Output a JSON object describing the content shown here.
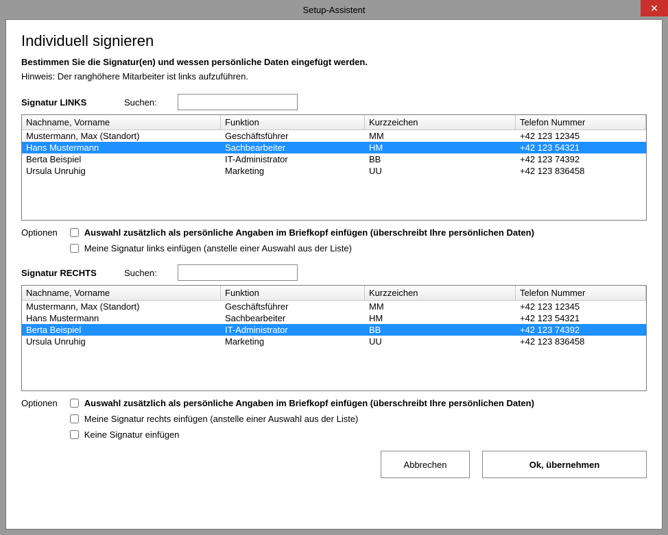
{
  "window": {
    "title": "Setup-Assistent",
    "close": "✕"
  },
  "heading": "Individuell signieren",
  "lead": "Bestimmen Sie die Signatur(en) und wessen persönliche Daten eingefügt werden.",
  "hint": "Hinweis: Der ranghöhere Mitarbeiter ist links aufzuführen.",
  "search_label": "Suchen:",
  "columns": {
    "name": "Nachname, Vorname",
    "func": "Funktion",
    "short": "Kurzzeichen",
    "phone": "Telefon Nummer"
  },
  "left": {
    "title": "Signatur LINKS",
    "search": "",
    "rows": [
      {
        "name": "Mustermann, Max (Standort)",
        "func": "Geschäftsführer",
        "short": "MM",
        "phone": "+42 123 12345",
        "selected": false
      },
      {
        "name": "Hans Mustermann",
        "func": "Sachbearbeiter",
        "short": "HM",
        "phone": "+42 123 54321",
        "selected": true
      },
      {
        "name": "Berta Beispiel",
        "func": "IT-Administrator",
        "short": "BB",
        "phone": "+42 123 74392",
        "selected": false
      },
      {
        "name": "Ursula Unruhig",
        "func": "Marketing",
        "short": "UU",
        "phone": "+42 123 836458",
        "selected": false
      }
    ],
    "options_label": "Optionen",
    "opt1": "Auswahl zusätzlich  als persönliche Angaben im Briefkopf einfügen (überschreibt Ihre persönlichen Daten)",
    "opt2": "Meine Signatur links einfügen (anstelle einer Auswahl aus der Liste)"
  },
  "right": {
    "title": "Signatur RECHTS",
    "search": "",
    "rows": [
      {
        "name": "Mustermann, Max (Standort)",
        "func": "Geschäftsführer",
        "short": "MM",
        "phone": "+42 123 12345",
        "selected": false
      },
      {
        "name": "Hans Mustermann",
        "func": "Sachbearbeiter",
        "short": "HM",
        "phone": "+42 123 54321",
        "selected": false
      },
      {
        "name": "Berta Beispiel",
        "func": "IT-Administrator",
        "short": "BB",
        "phone": "+42 123 74392",
        "selected": true
      },
      {
        "name": "Ursula Unruhig",
        "func": "Marketing",
        "short": "UU",
        "phone": "+42 123 836458",
        "selected": false
      }
    ],
    "options_label": "Optionen",
    "opt1": "Auswahl zusätzlich  als persönliche Angaben im Briefkopf einfügen (überschreibt Ihre persönlichen Daten)",
    "opt2": "Meine Signatur rechts einfügen (anstelle einer Auswahl aus der Liste)",
    "opt3": "Keine Signatur einfügen"
  },
  "buttons": {
    "cancel": "Abbrechen",
    "ok": "Ok, übernehmen"
  }
}
